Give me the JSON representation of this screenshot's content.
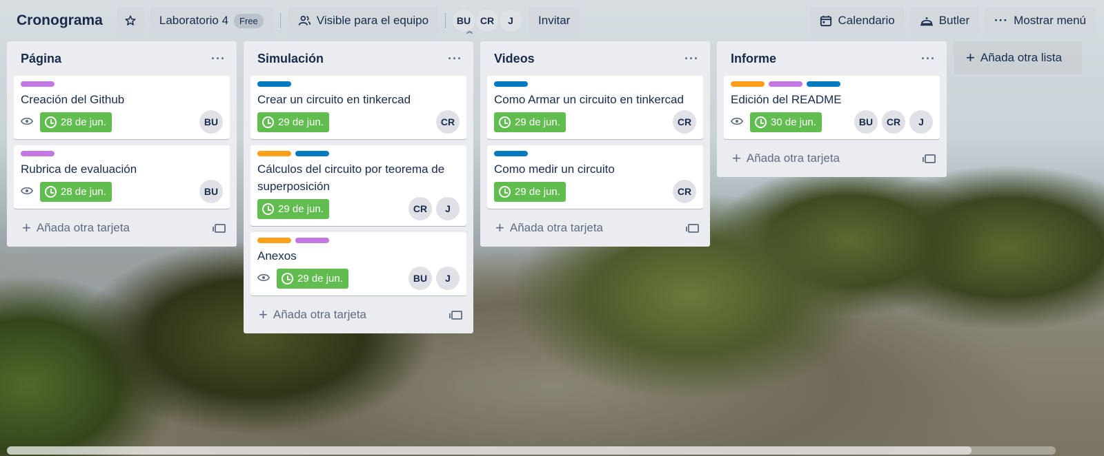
{
  "colors": {
    "purple": "#c377e0",
    "blue": "#0079bf",
    "orange": "#ff9f1a",
    "due_green": "#61bd4f"
  },
  "header": {
    "title": "Cronograma",
    "star_icon": "star-icon",
    "workspace": {
      "name": "Laboratorio 4",
      "badge": "Free"
    },
    "visibility": {
      "label": "Visible para el equipo",
      "icon": "people-icon"
    },
    "members": [
      "BU",
      "CR",
      "J"
    ],
    "invite_label": "Invitar",
    "calendar": {
      "label": "Calendario",
      "icon": "calendar-icon"
    },
    "butler": {
      "label": "Butler",
      "icon": "butler-icon"
    },
    "menu": {
      "label": "Mostrar menú",
      "icon": "ellipsis-icon"
    }
  },
  "add_list_label": "Añada otra lista",
  "horizontal_scroll_fraction": 0.92,
  "lists": [
    {
      "title": "Página",
      "menu": "···",
      "add_card_label": "Añada otra tarjeta",
      "cards": [
        {
          "labels": [
            "purple"
          ],
          "title": "Creación del Github",
          "watch": true,
          "due": "28 de jun.",
          "members": [
            "BU"
          ]
        },
        {
          "labels": [
            "purple"
          ],
          "title": "Rubrica de evaluación",
          "watch": true,
          "due": "28 de jun.",
          "members": [
            "BU"
          ]
        }
      ]
    },
    {
      "title": "Simulación",
      "menu": "···",
      "add_card_label": "Añada otra tarjeta",
      "cards": [
        {
          "labels": [
            "blue"
          ],
          "title": "Crear un circuito en tinkercad",
          "watch": false,
          "due": "29 de jun.",
          "members": [
            "CR"
          ]
        },
        {
          "labels": [
            "orange",
            "blue"
          ],
          "title": "Cálculos del circuito por teorema de superposición",
          "watch": false,
          "due": "29 de jun.",
          "members": [
            "CR",
            "J"
          ]
        },
        {
          "labels": [
            "orange",
            "purple"
          ],
          "title": "Anexos",
          "watch": true,
          "due": "29 de jun.",
          "members": [
            "BU",
            "J"
          ]
        }
      ]
    },
    {
      "title": "Videos",
      "menu": "···",
      "add_card_label": "Añada otra tarjeta",
      "cards": [
        {
          "labels": [
            "blue"
          ],
          "title": "Como Armar un circuito en tinkercad",
          "watch": false,
          "due": "29 de jun.",
          "members": [
            "CR"
          ]
        },
        {
          "labels": [
            "blue"
          ],
          "title": "Como medir un circuito",
          "watch": false,
          "due": "29 de jun.",
          "members": [
            "CR"
          ]
        }
      ]
    },
    {
      "title": "Informe",
      "menu": "···",
      "add_card_label": "Añada otra tarjeta",
      "cards": [
        {
          "labels": [
            "orange",
            "purple",
            "blue"
          ],
          "title": "Edición del README",
          "watch": true,
          "due": "30 de jun.",
          "members": [
            "BU",
            "CR",
            "J"
          ]
        }
      ]
    }
  ]
}
